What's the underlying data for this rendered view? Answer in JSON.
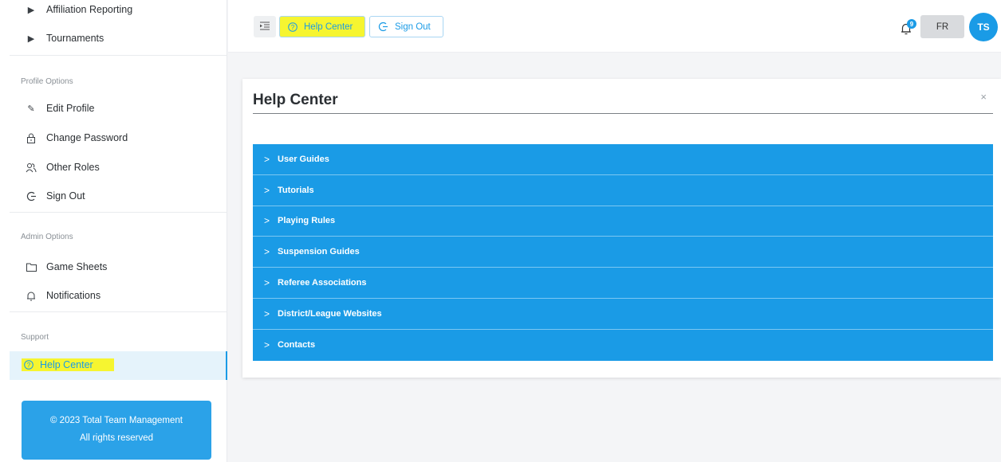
{
  "sidebar": {
    "top_items": [
      {
        "label": "Affiliation Reporting",
        "icon": "caret-right-icon"
      },
      {
        "label": "Tournaments",
        "icon": "caret-right-icon"
      }
    ],
    "profile_section": {
      "label": "Profile Options",
      "items": [
        {
          "label": "Edit Profile",
          "icon": "pencil-icon"
        },
        {
          "label": "Change Password",
          "icon": "lock-icon"
        },
        {
          "label": "Other Roles",
          "icon": "users-icon"
        },
        {
          "label": "Sign Out",
          "icon": "sign-out-icon"
        }
      ]
    },
    "admin_section": {
      "label": "Admin Options",
      "items": [
        {
          "label": "Game Sheets",
          "icon": "folder-icon"
        },
        {
          "label": "Notifications",
          "icon": "bell-icon"
        }
      ]
    },
    "support_section": {
      "label": "Support",
      "items": [
        {
          "label": "Help Center",
          "icon": "help-circle-icon",
          "active": true
        }
      ]
    },
    "footer": {
      "line1": "© 2023  Total Team Management",
      "line2": "All rights reserved"
    }
  },
  "topbar": {
    "help_label": "Help Center",
    "signout_label": "Sign Out",
    "notification_count": "9",
    "language": "FR",
    "avatar_initials": "TS"
  },
  "modal": {
    "title": "Help Center",
    "close": "×",
    "sections": [
      "User Guides",
      "Tutorials",
      "Playing Rules",
      "Suspension Guides",
      "Referee Associations",
      "District/League Websites",
      "Contacts"
    ]
  },
  "colors": {
    "accent": "#1a9be6",
    "highlight": "#f6f530",
    "footer": "#2ba2e8"
  }
}
